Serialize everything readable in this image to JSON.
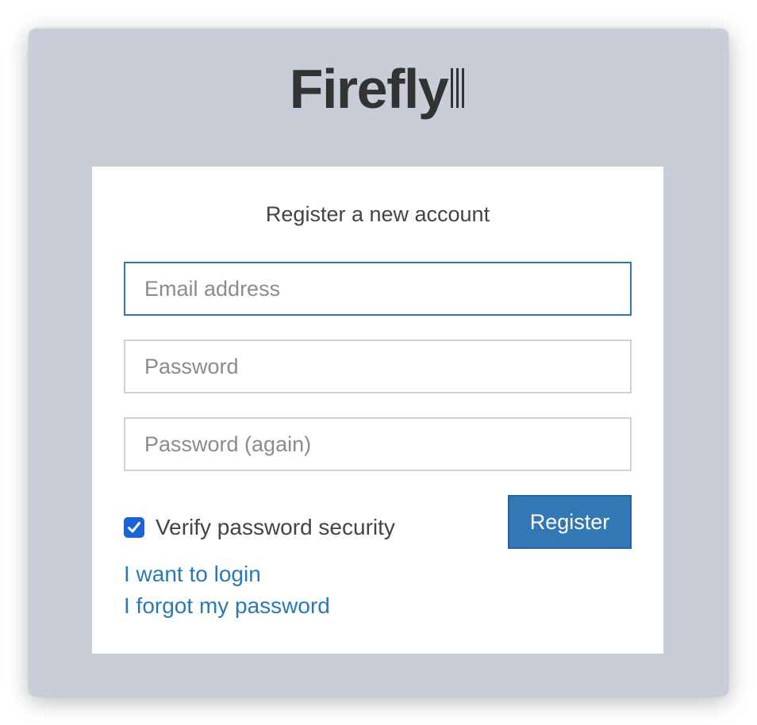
{
  "logo": {
    "text": "Firefly"
  },
  "form": {
    "title": "Register a new account",
    "email_placeholder": "Email address",
    "password_placeholder": "Password",
    "password_again_placeholder": "Password (again)",
    "verify_label": "Verify password security",
    "verify_checked": true,
    "register_label": "Register"
  },
  "links": {
    "login": "I want to login",
    "forgot": "I forgot my password"
  },
  "colors": {
    "window_bg": "#c8cdd8",
    "card_bg": "#ffffff",
    "button_bg": "#3278b5",
    "link": "#2a79b4",
    "checkbox": "#1a64d6"
  },
  "icons": {
    "checkbox": "checkmark-icon",
    "logo_bars": "roman-three-bars"
  }
}
